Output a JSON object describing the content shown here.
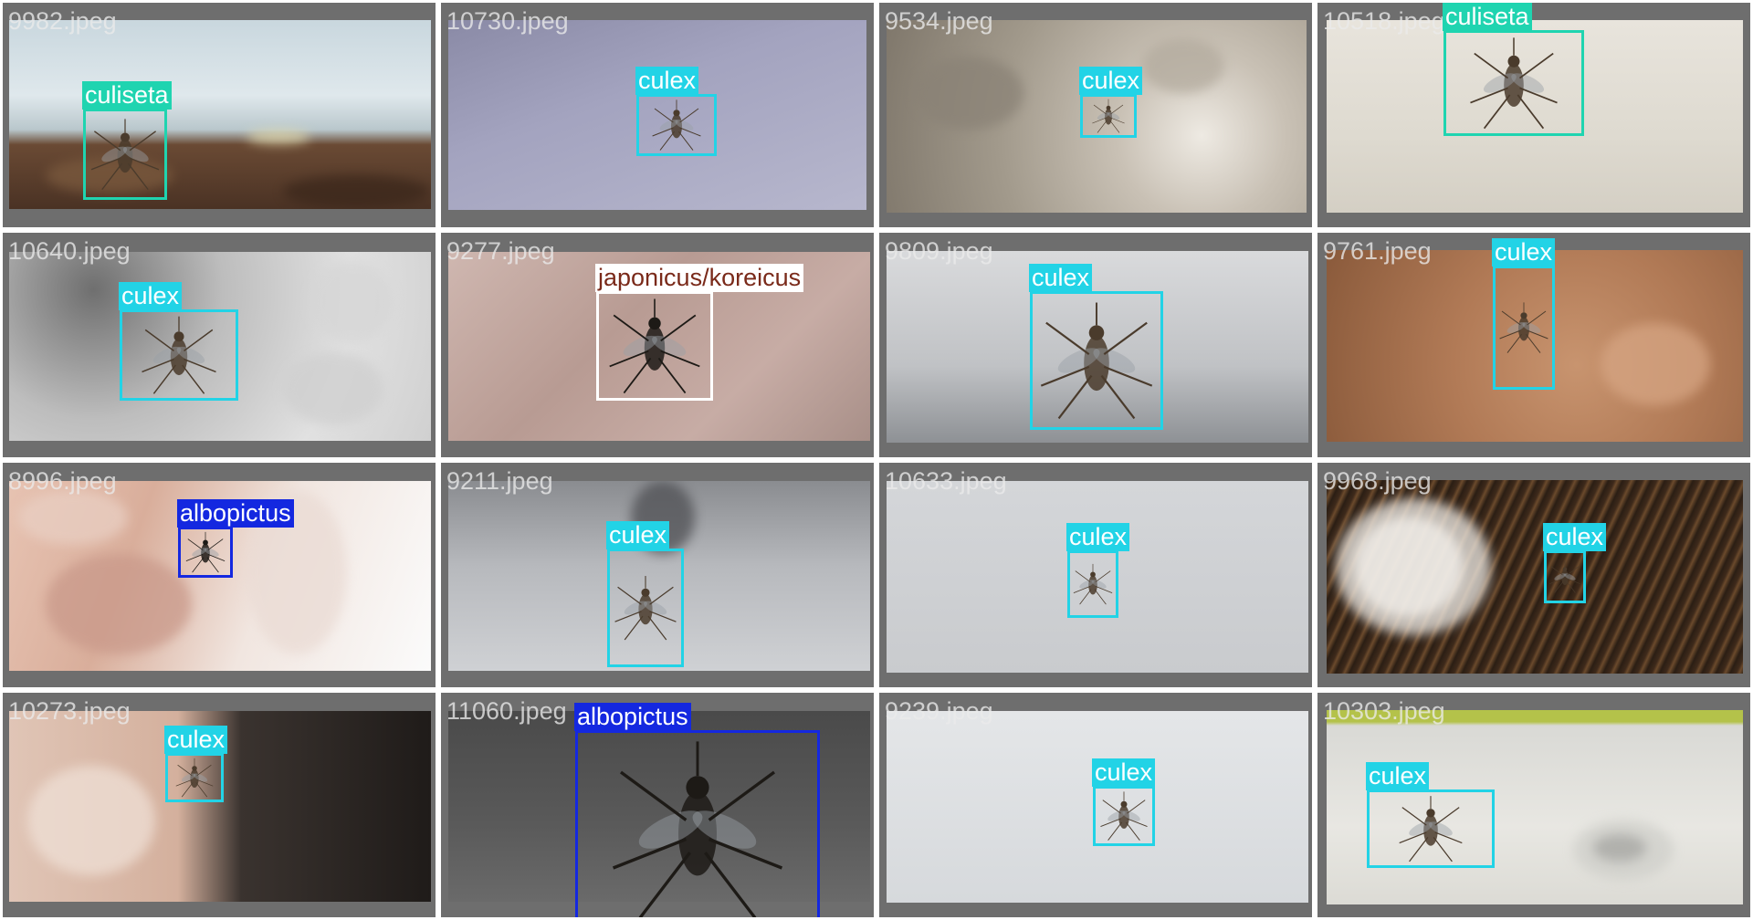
{
  "grid_title": "",
  "colors": {
    "culex": "#22d3e6",
    "culiseta": "#1fd4b0",
    "albopictus": "#1428e0",
    "japonicus/koreicus": "#ffffff",
    "tile_border": "#6e6e6e"
  },
  "tiles": [
    {
      "filename": "9982.jpeg",
      "detections": [
        {
          "label": "culiseta",
          "class": "culiseta"
        }
      ],
      "scene": "wall-wood"
    },
    {
      "filename": "10730.jpeg",
      "detections": [
        {
          "label": "culex",
          "class": "culex"
        }
      ],
      "scene": "lavender"
    },
    {
      "filename": "9534.jpeg",
      "detections": [
        {
          "label": "culex",
          "class": "culex"
        }
      ],
      "scene": "stone"
    },
    {
      "filename": "10518.jpeg",
      "detections": [
        {
          "label": "culiseta",
          "class": "culiseta"
        }
      ],
      "scene": "beige"
    },
    {
      "filename": "10640.jpeg",
      "detections": [
        {
          "label": "culex",
          "class": "culex"
        }
      ],
      "scene": "tissue"
    },
    {
      "filename": "9277.jpeg",
      "detections": [
        {
          "label": "japonicus/koreicus",
          "class": "japonicus/koreicus"
        }
      ],
      "scene": "skin-light"
    },
    {
      "filename": "9809.jpeg",
      "detections": [
        {
          "label": "culex",
          "class": "culex"
        }
      ],
      "scene": "grey-gradient"
    },
    {
      "filename": "9761.jpeg",
      "detections": [
        {
          "label": "culex",
          "class": "culex"
        }
      ],
      "scene": "palm"
    },
    {
      "filename": "8996.jpeg",
      "detections": [
        {
          "label": "albopictus",
          "class": "albopictus"
        }
      ],
      "scene": "fingers"
    },
    {
      "filename": "9211.jpeg",
      "detections": [
        {
          "label": "culex",
          "class": "culex"
        }
      ],
      "scene": "grey-shadow"
    },
    {
      "filename": "10633.jpeg",
      "detections": [
        {
          "label": "culex",
          "class": "culex"
        }
      ],
      "scene": "light-grey"
    },
    {
      "filename": "9968.jpeg",
      "detections": [
        {
          "label": "culex",
          "class": "culex"
        }
      ],
      "scene": "dark-wood"
    },
    {
      "filename": "10273.jpeg",
      "detections": [
        {
          "label": "culex",
          "class": "culex"
        }
      ],
      "scene": "thumb-dark"
    },
    {
      "filename": "11060.jpeg",
      "detections": [
        {
          "label": "albopictus",
          "class": "albopictus"
        }
      ],
      "scene": "asphalt"
    },
    {
      "filename": "9239.jpeg",
      "detections": [
        {
          "label": "culex",
          "class": "culex"
        }
      ],
      "scene": "white-wall"
    },
    {
      "filename": "10303.jpeg",
      "detections": [
        {
          "label": "culex",
          "class": "culex"
        }
      ],
      "scene": "plastic"
    }
  ]
}
